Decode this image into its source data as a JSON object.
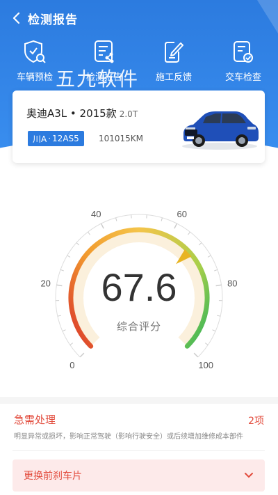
{
  "header": {
    "title": "检测报告"
  },
  "tabs": [
    {
      "label": "车辆预检",
      "icon": "shield-search-icon"
    },
    {
      "label": "检测报告",
      "icon": "report-share-icon"
    },
    {
      "label": "施工反馈",
      "icon": "edit-document-icon"
    },
    {
      "label": "交车检查",
      "icon": "checklist-icon"
    }
  ],
  "watermark": "五九软件",
  "car": {
    "model": "奥迪A3L • 2015款",
    "displacement": "2.0T",
    "plate_prefix": "川A",
    "plate_number": "12AS5",
    "mileage": "101015KM"
  },
  "gauge": {
    "score": "67.6",
    "label": "综合评分",
    "ticks": [
      "0",
      "20",
      "40",
      "60",
      "80",
      "100"
    ],
    "value": 67.6,
    "min": 0,
    "max": 100
  },
  "urgent": {
    "title": "急需处理",
    "count": "2项",
    "description": "明显异常或损坏，影响正常驾驶（影响行驶安全）或后续增加维修成本部件",
    "items": [
      "更换前刹车片"
    ]
  },
  "colors": {
    "primary": "#2c7bdf",
    "alert": "#e24a3b"
  }
}
